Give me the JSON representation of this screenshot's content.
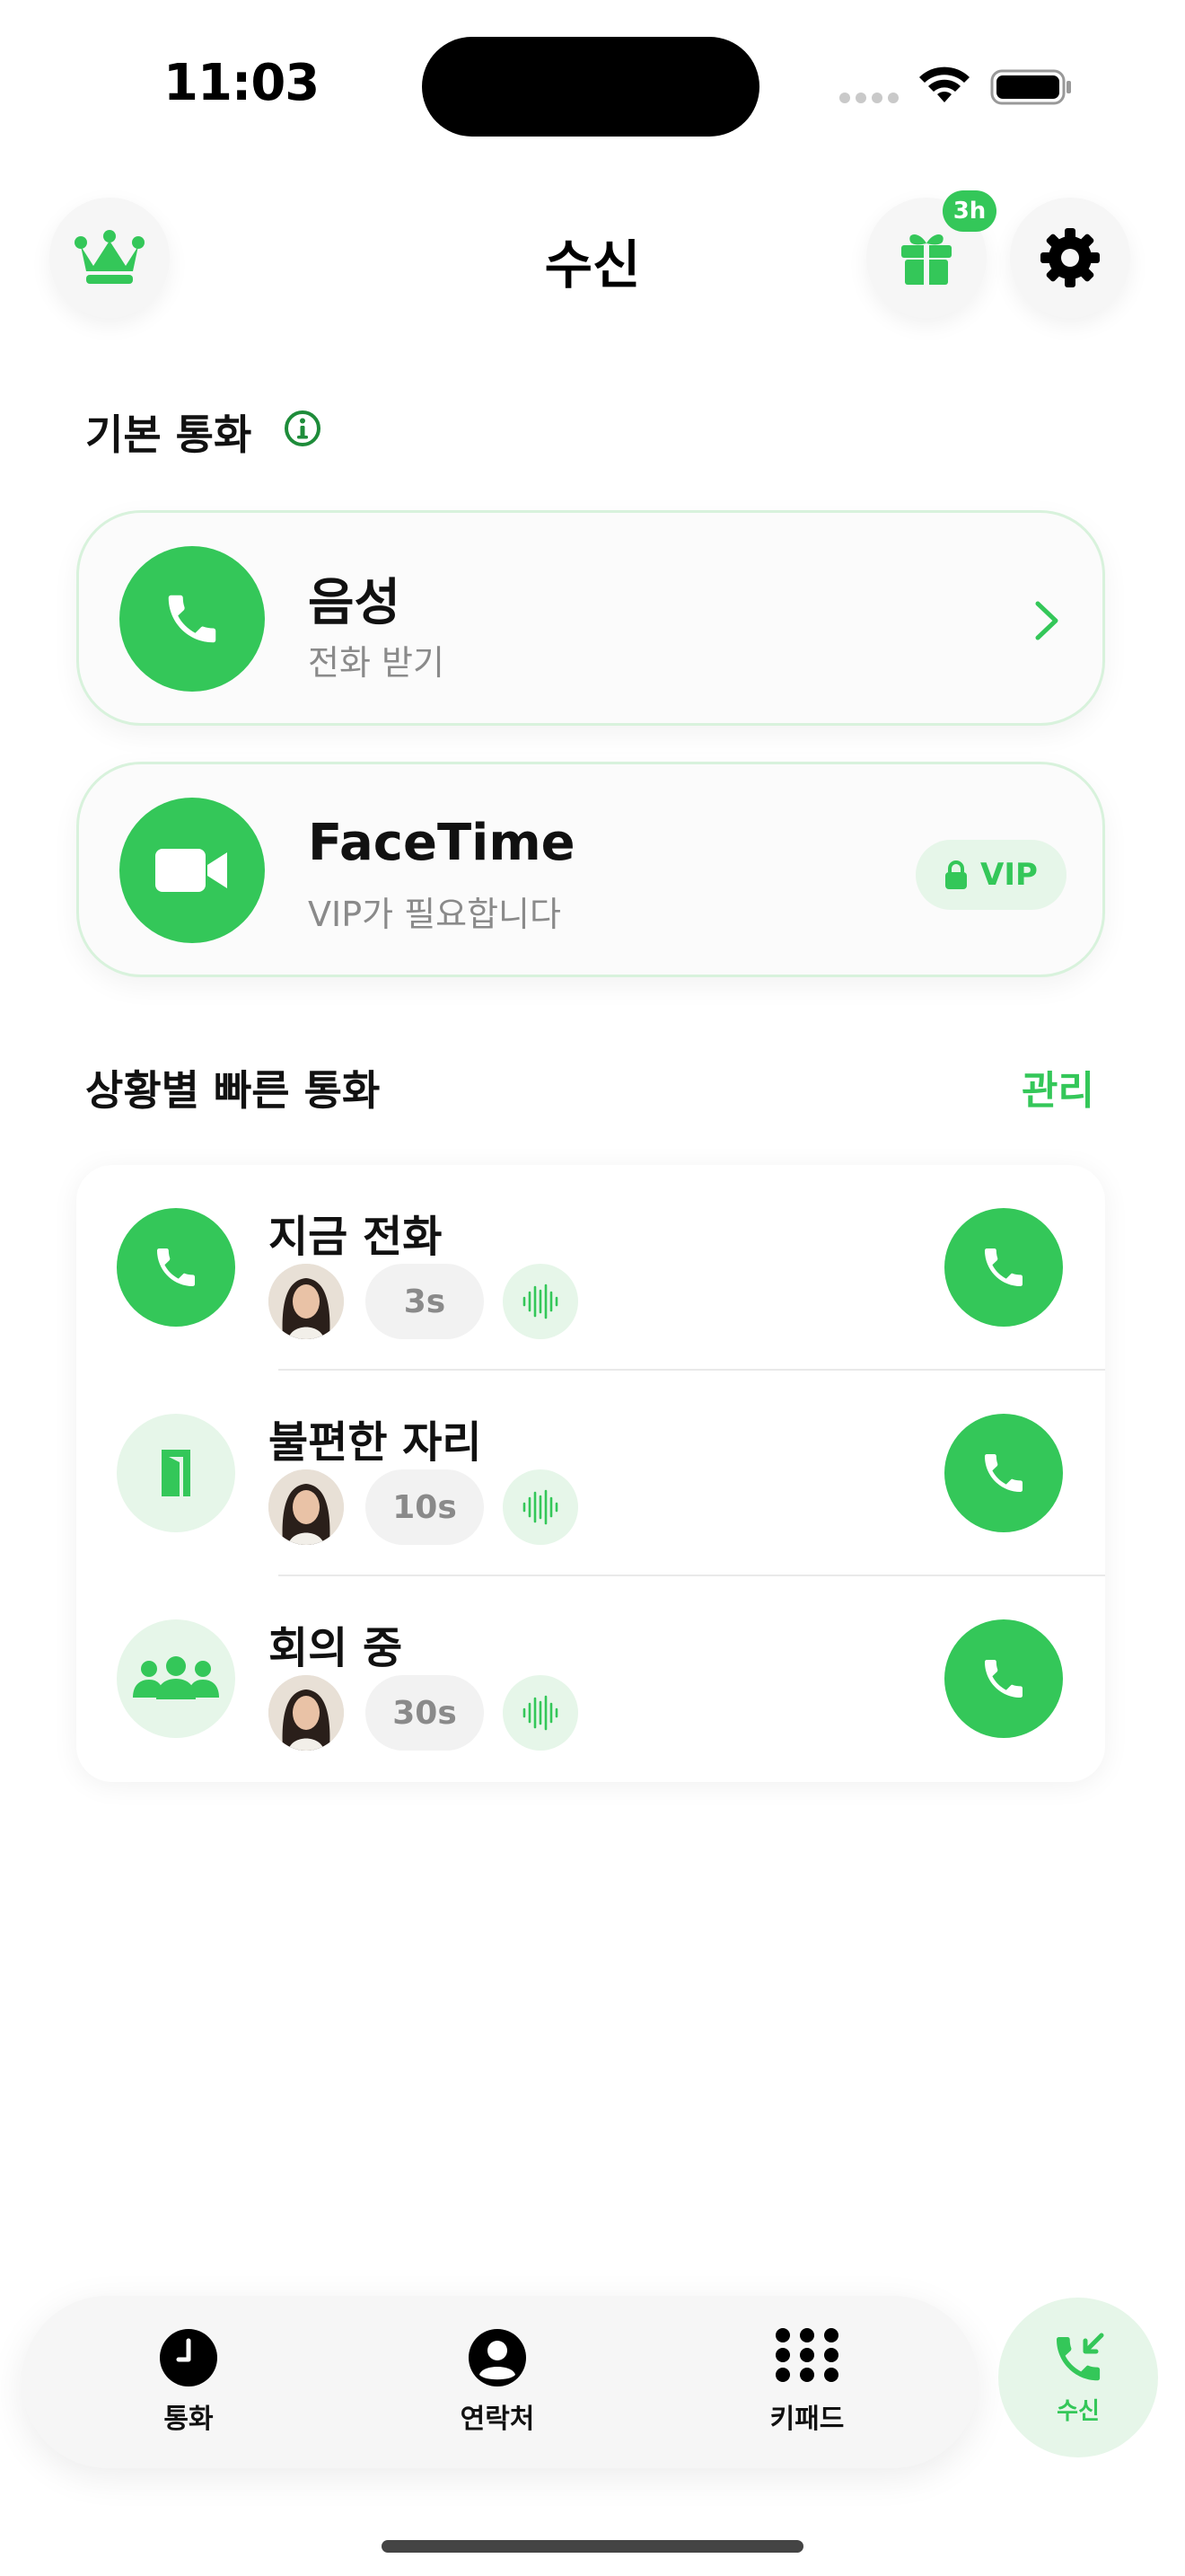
{
  "status_bar": {
    "time": "11:03"
  },
  "header": {
    "title": "수신",
    "gift_badge": "3h"
  },
  "basic_calls": {
    "section_title": "기본 통화",
    "voice": {
      "title": "음성",
      "subtitle": "전화 받기"
    },
    "facetime": {
      "title": "FaceTime",
      "subtitle": "VIP가 필요합니다",
      "badge": "VIP"
    }
  },
  "quick_calls": {
    "section_title": "상황별 빠른 통화",
    "manage_label": "관리",
    "items": [
      {
        "name": "지금 전화",
        "delay": "3s",
        "icon": "phone-icon"
      },
      {
        "name": "불편한 자리",
        "delay": "10s",
        "icon": "door-icon"
      },
      {
        "name": "회의 중",
        "delay": "30s",
        "icon": "group-icon"
      }
    ]
  },
  "tabbar": {
    "calls": "통화",
    "contacts": "연락처",
    "keypad": "키패드",
    "incoming": "수신"
  },
  "colors": {
    "accent": "#34c759",
    "accent_light": "#e6f6e9"
  }
}
